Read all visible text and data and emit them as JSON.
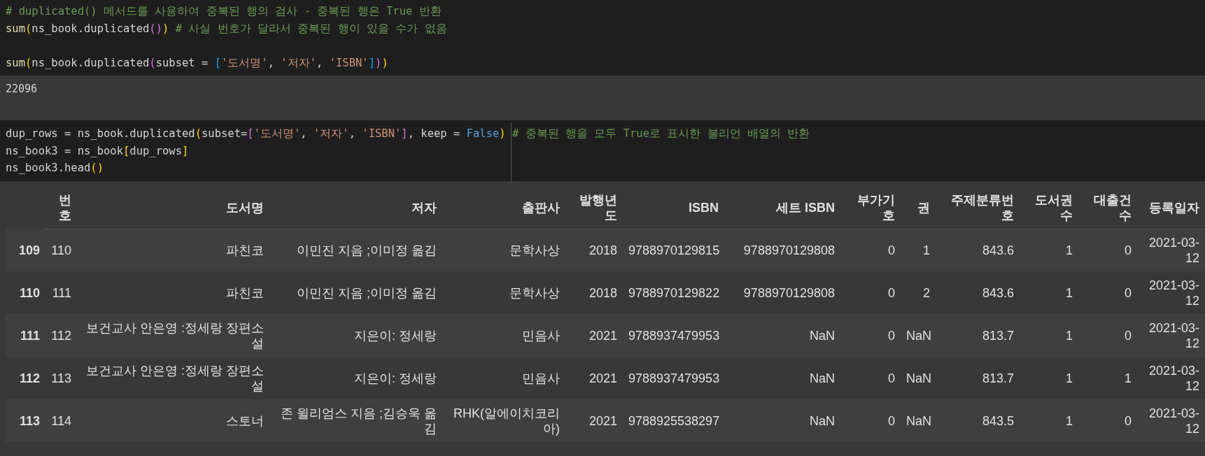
{
  "cells": [
    {
      "kind": "code",
      "blocks": [
        [
          [
            {
              "kind": "comment",
              "text": "# duplicated() 메서드를 사용하여 중복된 행의 검사 - 중복된 행은 True 반환"
            }
          ],
          [
            {
              "kind": "func",
              "text": "sum"
            },
            {
              "kind": "paren1",
              "text": "("
            },
            {
              "kind": "plain",
              "text": "ns_book.duplicated"
            },
            {
              "kind": "paren2",
              "text": "()"
            },
            {
              "kind": "paren1",
              "text": ")"
            },
            {
              "kind": "comment",
              "text": " # 사실 번호가 달라서 중복된 행이 있을 수가 없음"
            }
          ]
        ],
        [
          [
            {
              "kind": "func",
              "text": "sum"
            },
            {
              "kind": "paren1",
              "text": "("
            },
            {
              "kind": "plain",
              "text": "ns_book.duplicated"
            },
            {
              "kind": "paren2",
              "text": "("
            },
            {
              "kind": "plain",
              "text": "subset = "
            },
            {
              "kind": "bracket",
              "text": "["
            },
            {
              "kind": "string",
              "text": "'도서명'"
            },
            {
              "kind": "plain",
              "text": ", "
            },
            {
              "kind": "string",
              "text": "'저자'"
            },
            {
              "kind": "plain",
              "text": ", "
            },
            {
              "kind": "string",
              "text": "'ISBN'"
            },
            {
              "kind": "bracket",
              "text": "]"
            },
            {
              "kind": "paren2",
              "text": ")"
            },
            {
              "kind": "paren1",
              "text": ")"
            }
          ]
        ]
      ]
    },
    {
      "kind": "output",
      "text": "22096"
    },
    {
      "kind": "code",
      "blocks": [
        [
          [
            {
              "kind": "plain",
              "text": "dup_rows = ns_book.duplicated"
            },
            {
              "kind": "paren1",
              "text": "("
            },
            {
              "kind": "plain",
              "text": "subset="
            },
            {
              "kind": "paren2",
              "text": "["
            },
            {
              "kind": "string",
              "text": "'도서명'"
            },
            {
              "kind": "plain",
              "text": ", "
            },
            {
              "kind": "string",
              "text": "'저자'"
            },
            {
              "kind": "plain",
              "text": ", "
            },
            {
              "kind": "string",
              "text": "'ISBN'"
            },
            {
              "kind": "paren2",
              "text": "]"
            },
            {
              "kind": "plain",
              "text": ", keep = "
            },
            {
              "kind": "keyword",
              "text": "False"
            },
            {
              "kind": "paren1",
              "text": ")"
            },
            {
              "kind": "comment",
              "text": " # 중복된 행을 모두 True로 표시한 불리언 배열의 반환"
            }
          ],
          [
            {
              "kind": "plain",
              "text": "ns_book3 = ns_book"
            },
            {
              "kind": "paren1",
              "text": "["
            },
            {
              "kind": "plain",
              "text": "dup_rows"
            },
            {
              "kind": "paren1",
              "text": "]"
            }
          ],
          [
            {
              "kind": "plain",
              "text": "ns_book3.head"
            },
            {
              "kind": "paren1",
              "text": "()"
            }
          ]
        ]
      ]
    },
    {
      "kind": "table",
      "columns": [
        "번호",
        "도서명",
        "저자",
        "출판사",
        "발행년도",
        "ISBN",
        "세트 ISBN",
        "부가기호",
        "권",
        "주제분류번호",
        "도서권수",
        "대출건수",
        "등록일자"
      ],
      "rows": [
        {
          "index": "109",
          "cells": [
            "110",
            "파친코",
            "이민진 지음 ;이미정 옮김",
            "문학사상",
            "2018",
            "9788970129815",
            "9788970129808",
            "0",
            "1",
            "843.6",
            "1",
            "0",
            "2021-03-12"
          ]
        },
        {
          "index": "110",
          "cells": [
            "111",
            "파친코",
            "이민진 지음 ;이미정 옮김",
            "문학사상",
            "2018",
            "9788970129822",
            "9788970129808",
            "0",
            "2",
            "843.6",
            "1",
            "0",
            "2021-03-12"
          ]
        },
        {
          "index": "111",
          "cells": [
            "112",
            "보건교사 안은영 :정세랑 장편소설",
            "지은이: 정세랑",
            "민음사",
            "2021",
            "9788937479953",
            "NaN",
            "0",
            "NaN",
            "813.7",
            "1",
            "0",
            "2021-03-12"
          ]
        },
        {
          "index": "112",
          "cells": [
            "113",
            "보건교사 안은영 :정세랑 장편소설",
            "지은이: 정세랑",
            "민음사",
            "2021",
            "9788937479953",
            "NaN",
            "0",
            "NaN",
            "813.7",
            "1",
            "1",
            "2021-03-12"
          ]
        },
        {
          "index": "113",
          "cells": [
            "114",
            "스토너",
            "존 윌리엄스 지음 ;김승욱 옮김",
            "RHK(알에이치코리아)",
            "2021",
            "9788925538297",
            "NaN",
            "0",
            "NaN",
            "843.5",
            "1",
            "0",
            "2021-03-12"
          ]
        }
      ]
    }
  ]
}
